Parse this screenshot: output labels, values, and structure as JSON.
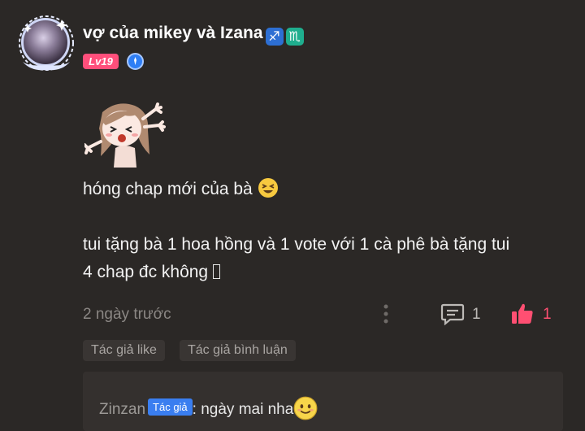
{
  "user": {
    "name": "vợ của mikey và Izana",
    "zodiac": [
      "♐",
      "♏"
    ],
    "level": "Lv19",
    "author_icon": "author-icon"
  },
  "comment": {
    "line1": "hóng chap mới của bà",
    "line2": "tui tặng bà 1 hoa hồng và 1 vote với 1 cà phê bà tặng tui",
    "line3": "4 chap đc không",
    "sticker": "anime-girl-sticker"
  },
  "meta": {
    "time": "2 ngày trước",
    "reply_count": "1",
    "like_count": "1"
  },
  "tags": [
    "Tác giả like",
    "Tác giả bình luận"
  ],
  "reply": {
    "user": "Zinzan",
    "badge": "Tác giả",
    "text": ": ngày mai nha"
  },
  "colors": {
    "background": "#2b2826",
    "like": "#ff4f72",
    "level_badge": "#ff4f7b",
    "author_badge": "#3a7ef0"
  }
}
